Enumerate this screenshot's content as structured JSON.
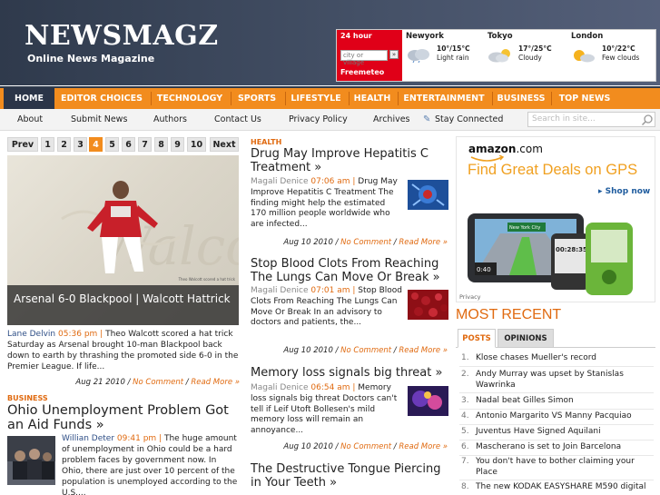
{
  "site": {
    "logo": "NEWSMAGZ",
    "tagline": "Online News Magazine"
  },
  "weather": {
    "widget_title": "24 hour",
    "input_placeholder": "city or village",
    "go_label": "»",
    "brand": "Freemeteo",
    "cities": [
      {
        "name": "Newyork",
        "temp": "10°/15°C",
        "condition": "Light rain",
        "icon": "rain-cloud-icon"
      },
      {
        "name": "Tokyo",
        "temp": "17°/25°C",
        "condition": "Cloudy",
        "icon": "cloud-sun-icon"
      },
      {
        "name": "London",
        "temp": "10°/22°C",
        "condition": "Few clouds",
        "icon": "few-clouds-icon"
      }
    ]
  },
  "nav_main": [
    "HOME",
    "EDITOR CHOICES",
    "TECHNOLOGY",
    "SPORTS",
    "LIFESTYLE",
    "HEALTH",
    "ENTERTAINMENT",
    "BUSINESS",
    "TOP NEWS"
  ],
  "nav_secondary": [
    "About",
    "Submit News",
    "Authors",
    "Contact Us",
    "Privacy Policy",
    "Archives",
    "Stay Connected"
  ],
  "search": {
    "placeholder": "Search in site..."
  },
  "pager": {
    "prev": "Prev",
    "next": "Next",
    "pages": [
      "1",
      "2",
      "3",
      "4",
      "5",
      "6",
      "7",
      "8",
      "9",
      "10"
    ],
    "current": "4"
  },
  "featured": {
    "caption": "Arsenal 6-0 Blackpool | Walcott Hattrick",
    "photo_credit": "Theo Walcott scored a hat trick",
    "author": "Lane Delvin",
    "time": "05:36 pm",
    "excerpt": "Theo Walcott scored a hat trick Saturday as Arsenal brought 10-man Blackpool back down to earth by thrashing the promoted side 6-0 in the Premier League. If life...",
    "date": "Aug 21 2010",
    "comments": "No Comment",
    "more": "Read More »"
  },
  "business": {
    "category": "BUSINESS",
    "title": "Ohio Unemployment Problem Got an Aid Funds »",
    "author": "Willian Deter",
    "time": "09:41 pm",
    "excerpt": "The huge amount of unemployment in Ohio could be a hard problem faces by government now. In Ohio, there are just over 10 percent of the population is unemployed according to the U.S...."
  },
  "articles": [
    {
      "category": "HEALTH",
      "title": "Drug May Improve Hepatitis C Treatment »",
      "author": "Magali Denice",
      "time": "07:06 am",
      "excerpt": "Drug May Improve Hepatitis C Treatment The finding might help the estimated 170 million people worldwide who are infected...",
      "date": "Aug 10 2010",
      "comments": "No Comment",
      "more": "Read More »"
    },
    {
      "title": "Stop Blood Clots From Reaching The Lungs Can Move Or Break »",
      "author": "Magali Denice",
      "time": "07:01 am",
      "excerpt": "Stop Blood Clots From Reaching The Lungs Can Move Or Break In an advisory to doctors and patients, the...",
      "date": "Aug 10 2010",
      "comments": "No Comment",
      "more": "Read More »"
    },
    {
      "title": "Memory loss signals big threat »",
      "author": "Magali Denice",
      "time": "06:54 am",
      "excerpt": "Memory loss signals big threat Doctors can't tell if Leif Utoft Bollesen's mild memory loss will remain an annoyance...",
      "date": "Aug 10 2010",
      "comments": "No Comment",
      "more": "Read More »"
    },
    {
      "title": "The Destructive Tongue Piercing in Your Teeth »"
    }
  ],
  "ad": {
    "brand": "amazon",
    "brand_suffix": ".com",
    "headline": "Find Great Deals on GPS",
    "cta": "Shop now",
    "privacy": "Privacy",
    "sign_text": "New York City",
    "screen_time": "0:40",
    "device_clock": "00:28:35"
  },
  "sidebar": {
    "heading": "MOST RECENT",
    "tabs": [
      "POSTS",
      "OPINIONS"
    ],
    "recent": [
      "Klose chases Mueller's record",
      "Andy Murray was upset by Stanislas Wawrinka",
      "Nadal beat Gilles Simon",
      "Antonio Margarito VS Manny Pacquiao",
      "Juventus Have Signed Aquilani",
      "Mascherano is set to Join Barcelona",
      "You don't have to bother claiming your Place",
      "The new KODAK EASYSHARE M590 digital"
    ]
  },
  "colors": {
    "accent": "#f28c1e",
    "header": "#2f3a4c",
    "link": "#2e4e86",
    "meta": "#e06a10"
  }
}
